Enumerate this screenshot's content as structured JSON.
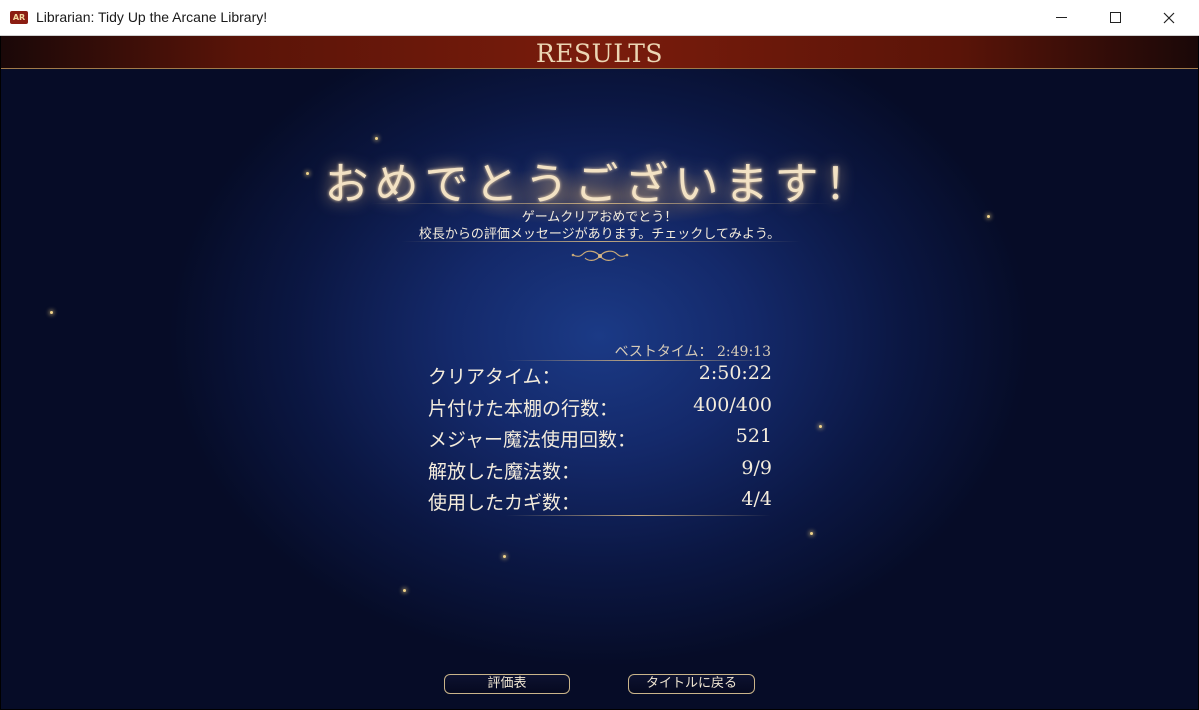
{
  "window": {
    "title": "Librarian: Tidy Up the Arcane Library!",
    "icon_text": "AR"
  },
  "header": {
    "title": "RESULTS"
  },
  "congrats": {
    "title": "おめでとうございます！",
    "line1": "ゲームクリアおめでとう！",
    "line2": "校長からの評価メッセージがあります。チェックしてみよう。"
  },
  "best_time": {
    "label": "ベストタイム：",
    "value": "2:49:13"
  },
  "stats": [
    {
      "label": "クリアタイム：",
      "value": "2:50:22"
    },
    {
      "label": "片付けた本棚の行数：",
      "value": "400/400"
    },
    {
      "label": "メジャー魔法使用回数：",
      "value": "521"
    },
    {
      "label": "解放した魔法数：",
      "value": "9/9"
    },
    {
      "label": "使用したカギ数：",
      "value": "4/4"
    }
  ],
  "buttons": {
    "evaluation": "評価表",
    "back_to_title": "タイトルに戻る"
  },
  "colors": {
    "accent": "#ecd6b4",
    "header_band": "#7a1c0c",
    "background": "#14296a"
  }
}
